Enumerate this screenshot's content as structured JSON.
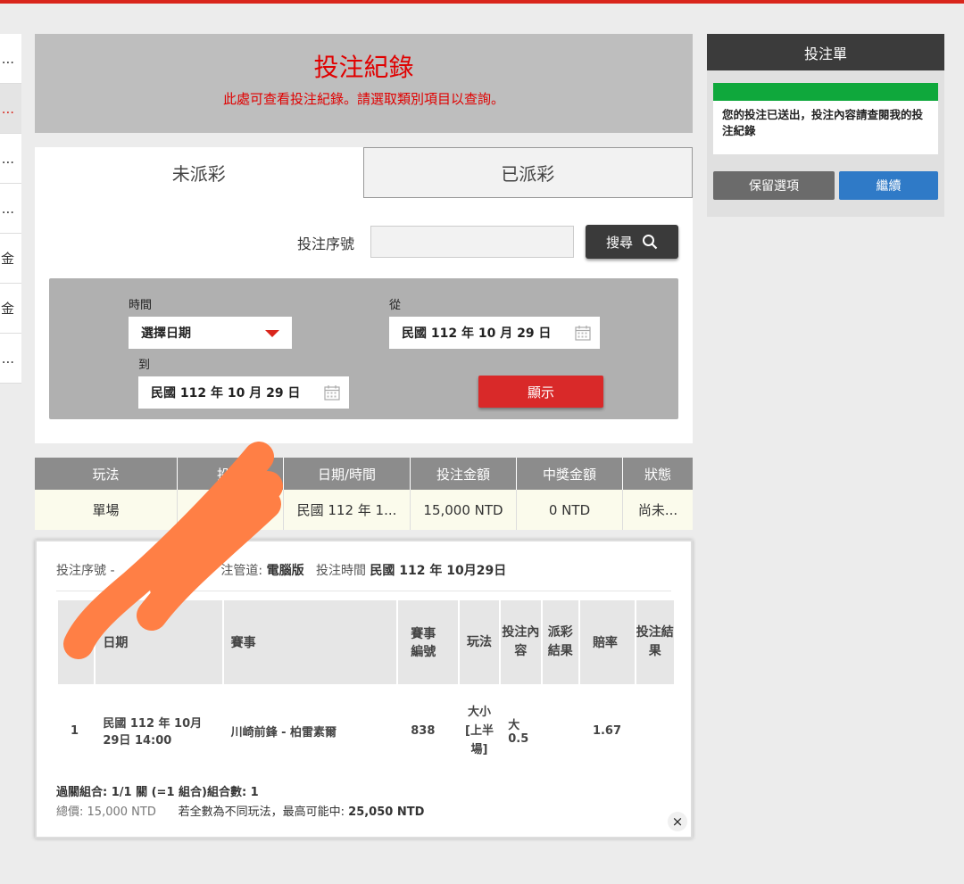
{
  "left_nav": {
    "items": [
      "...",
      "...",
      "...",
      "...",
      "金",
      "金",
      "..."
    ]
  },
  "header": {
    "title": "投注紀錄",
    "subtitle": "此處可查看投注紀錄。請選取類別項目以查詢。"
  },
  "tabs": [
    {
      "label": "未派彩",
      "active": true
    },
    {
      "label": "已派彩",
      "active": false
    }
  ],
  "search": {
    "label": "投注序號",
    "value": "",
    "button_label": "搜尋"
  },
  "filter": {
    "time_label": "時間",
    "time_select": "選擇日期",
    "from_label": "從",
    "from_value": "民國 112 年 10 月 29 日",
    "to_label": "到",
    "to_value": "民國 112 年 10 月 29 日",
    "show_button": "顯示"
  },
  "records_table": {
    "headers": [
      "玩法",
      "投注",
      "日期/時間",
      "投注金額",
      "中獎金額",
      "狀態"
    ],
    "rows": [
      [
        "單場",
        "",
        "民國 112 年 1...",
        "15,000 NTD",
        "0 NTD",
        "尚未..."
      ]
    ]
  },
  "detail": {
    "meta_serial_label": "投注序號 -",
    "meta_channel_label": "注管道:",
    "meta_channel_value": "電腦版",
    "meta_time_label": "投注時間",
    "meta_time_value": "民國 112 年 10月29日",
    "table_headers": [
      "#",
      "日期",
      "賽事",
      "賽事編號",
      "玩法",
      "投注內容",
      "派彩結果",
      "賠率",
      "投注結果"
    ],
    "row": {
      "num": "1",
      "date": "民國 112 年 10月29日 14:00",
      "match": "川崎前鋒 - 柏雷素爾",
      "match_id": "838",
      "play": "大小[上半場]",
      "content": "大0.5",
      "payout": "",
      "odds": "1.67",
      "result": ""
    },
    "combo_line": "過關組合: 1/1 關 (=1 組合)組合數: 1",
    "total_label": "總價:",
    "total_value": "15,000 NTD",
    "max_win_label": "若全數為不同玩法，最高可能中:",
    "max_win_value": "25,050 NTD",
    "close_symbol": "×"
  },
  "bet_slip": {
    "title": "投注單",
    "message": "您的投注已送出，投注內容請查閱我的投注紀錄",
    "keep_button": "保留選項",
    "continue_button": "繼續"
  },
  "colors": {
    "accent_red": "#d9261c",
    "success_green": "#0fa83c",
    "primary_blue": "#2f7ac7",
    "scribble": "#ff7f45"
  }
}
